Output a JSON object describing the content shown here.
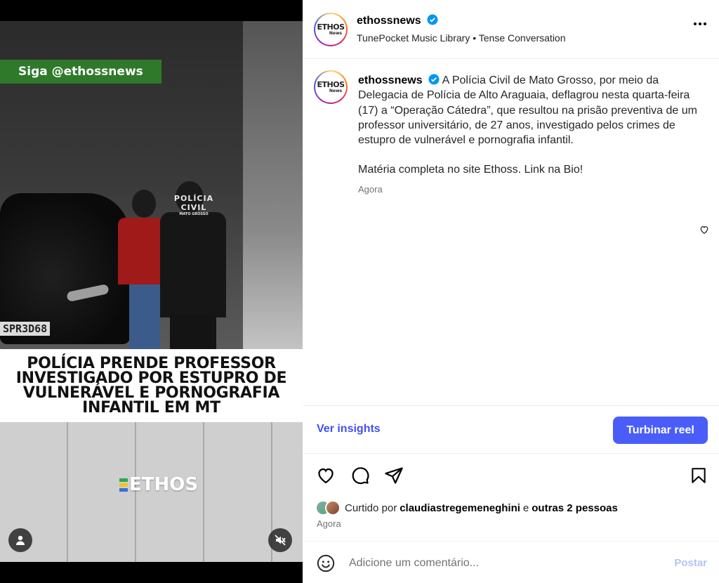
{
  "video": {
    "overlay_tag": "Siga @ethossnews",
    "headline": "POLÍCIA PRENDE PROFESSOR INVESTIGADO POR ESTUPRO DE VULNERÁVEL E PORNOGRAFIA INFANTIL EM MT",
    "vest_text_1": "POLÍCIA",
    "vest_text_2": "CIVIL",
    "vest_text_3": "MATO GROSSO",
    "plate": "SPR3D68",
    "logo_text": "ETHOS",
    "logo_colors": [
      "#2fa84f",
      "#f5c518",
      "#3b6fd6"
    ],
    "user_icon": "user-icon",
    "mute_icon": "muted-speaker-icon"
  },
  "header": {
    "avatar_text_top": "ETHOS",
    "avatar_text_bottom": "News",
    "username": "ethossnews",
    "audio_source": "TunePocket Music Library",
    "separator": "•",
    "audio_title": "Tense Conversation",
    "more_icon": "more-options-icon"
  },
  "caption": {
    "username": "ethossnews",
    "text": "A Polícia Civil de Mato Grosso, por meio da Delegacia de Polícia de Alto Araguaia, deflagrou nesta quarta-feira (17) a “Operação Cátedra”, que resultou na prisão preventiva de um professor universitário, de 27 anos, investigado pelos crimes de estupro de vulnerável e pornografia infantil.",
    "text2": "Matéria completa no site Ethoss. Link na Bio!",
    "time": "Agora"
  },
  "insights": {
    "link_label": "Ver insights",
    "boost_label": "Turbinar reel"
  },
  "likes": {
    "prefix": "Curtido por",
    "user": "claudiastregemeneghini",
    "conj": "e",
    "others": "outras 2 pessoas",
    "time": "Agora"
  },
  "comment": {
    "placeholder": "Adicione um comentário...",
    "post_label": "Postar"
  },
  "colors": {
    "accent": "#4a5df9",
    "link": "#4150f7",
    "verified": "#0095f6",
    "overlay_green": "#2e7a2a"
  }
}
